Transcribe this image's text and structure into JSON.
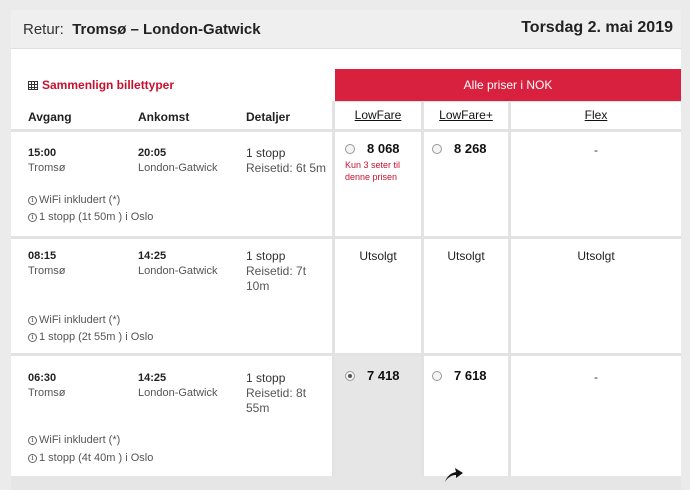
{
  "header": {
    "prefix": "Retur:",
    "route": "Tromsø – London-Gatwick",
    "date": "Torsdag 2. mai 2019"
  },
  "compare_link": "Sammenlign billettyper",
  "banner": "Alle priser i NOK",
  "columns": {
    "departure": "Avgang",
    "arrival": "Ankomst",
    "details": "Detaljer"
  },
  "fare_types": [
    "LowFare",
    "LowFare+",
    "Flex"
  ],
  "flights": [
    {
      "dep_time": "15:00",
      "dep_place": "Tromsø",
      "arr_time": "20:05",
      "arr_place": "London-Gatwick",
      "stops": "1 stopp",
      "duration": "Reisetid: 6t 5m",
      "wifi": "WiFi inkludert (*)",
      "stop_info": "1 stopp (1t 50m ) i Oslo",
      "lowfare": "8 068",
      "lowfare_note": "Kun 3 seter til denne prisen",
      "lowfare_plus": "8 268",
      "flex": "-"
    },
    {
      "dep_time": "08:15",
      "dep_place": "Tromsø",
      "arr_time": "14:25",
      "arr_place": "London-Gatwick",
      "stops": "1 stopp",
      "duration": "Reisetid: 7t 10m",
      "wifi": "WiFi inkludert (*)",
      "stop_info": "1 stopp (2t 55m ) i Oslo",
      "lowfare": "Utsolgt",
      "lowfare_plus": "Utsolgt",
      "flex": "Utsolgt"
    },
    {
      "dep_time": "06:30",
      "dep_place": "Tromsø",
      "arr_time": "14:25",
      "arr_place": "London-Gatwick",
      "stops": "1 stopp",
      "duration": "Reisetid: 8t 55m",
      "wifi": "WiFi inkludert (*)",
      "stop_info": "1 stopp (4t 40m ) i Oslo",
      "lowfare": "7 418",
      "lowfare_selected": true,
      "lowfare_plus": "7 618",
      "flex": "-"
    }
  ],
  "icons": {
    "compare": "table-icon",
    "info": "info-icon",
    "cursor": "curved-arrow-cursor-icon"
  },
  "colors": {
    "accent": "#d7213e",
    "link_red": "#c8102e"
  }
}
